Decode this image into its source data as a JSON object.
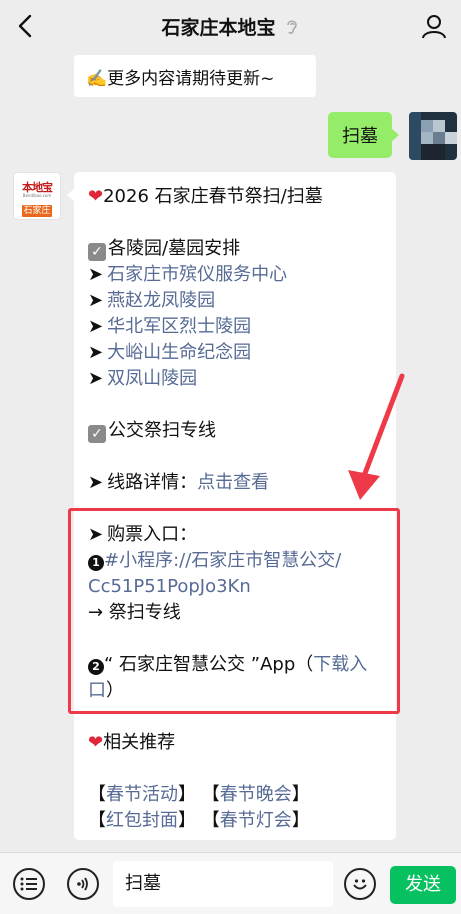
{
  "header": {
    "title": "石家庄本地宝"
  },
  "messages": {
    "top_text": "✍️更多内容请期待更新~",
    "user_text": "扫墓",
    "bot_logo": {
      "line1": "本地宝",
      "line2": "Bendibao.com",
      "line3": "石家庄"
    },
    "content": {
      "title": "2026 石家庄春节祭扫/扫墓",
      "section1_title": "各陵园/墓园安排",
      "cemeteries": [
        "石家庄市殡仪服务中心",
        "燕赵龙凤陵园",
        "华北军区烈士陵园",
        "大峪山生命纪念园",
        "双凤山陵园"
      ],
      "section2_title": "公交祭扫专线",
      "route_label": "线路详情：",
      "route_link": "点击查看",
      "ticket_label": "购票入口：",
      "mini_num": "1",
      "mini_link_1": "#小程序://石家庄市智慧公交/",
      "mini_link_2": "Cc51P51PopJo3Kn",
      "mini_after": "→ 祭扫专线",
      "app_num": "2",
      "app_text": "“ 石家庄智慧公交 ”App（",
      "app_link_1": "下载入",
      "app_link_2": "口",
      "app_close": "）",
      "related_title": "相关推荐",
      "rec": [
        {
          "open": "【",
          "label": "春节活动",
          "close": "】"
        },
        {
          "open": "【",
          "label": "春节晚会",
          "close": "】"
        },
        {
          "open": "【",
          "label": "红包封面",
          "close": "】"
        },
        {
          "open": "【",
          "label": "春节灯会",
          "close": "】"
        }
      ]
    }
  },
  "bottom": {
    "input_value": "扫墓",
    "send_label": "发送"
  },
  "colors": {
    "link": "#576b95",
    "send": "#07c160",
    "my_bubble": "#95ec69",
    "highlight": "#ee3a48"
  }
}
